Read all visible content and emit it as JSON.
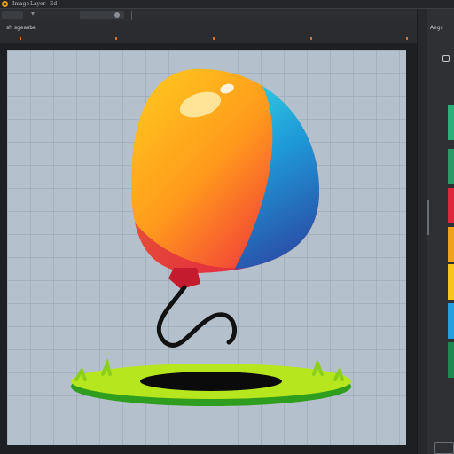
{
  "menubar": {
    "items": [
      "Image",
      "Layer",
      "Ed"
    ]
  },
  "tab": {
    "name": "sh sgeasba",
    "close": "×"
  },
  "panel": {
    "header": "Aegs"
  },
  "swatches": [
    "#2bb07a",
    "#2c9a66",
    "#e0283c",
    "#f0a21c",
    "#f7c51c",
    "#23a0e0",
    "#1d8a52"
  ]
}
